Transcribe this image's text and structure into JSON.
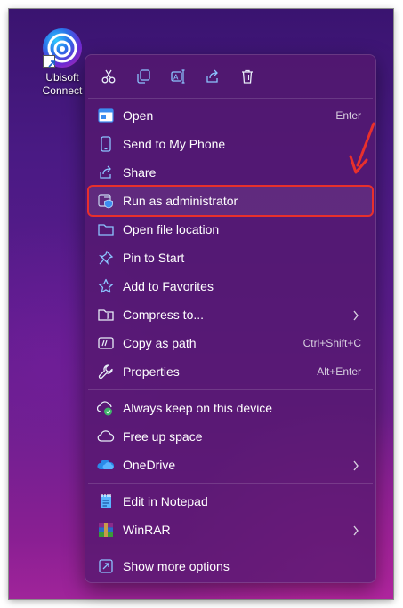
{
  "desktop": {
    "icon_label_line1": "Ubisoft",
    "icon_label_line2": "Connect",
    "icon": "ubisoft-connect-icon"
  },
  "toolbar": [
    {
      "name": "cut",
      "icon": "scissors-icon"
    },
    {
      "name": "copy",
      "icon": "copy-icon"
    },
    {
      "name": "rename",
      "icon": "rename-icon"
    },
    {
      "name": "share",
      "icon": "share-icon"
    },
    {
      "name": "delete",
      "icon": "trash-icon"
    }
  ],
  "menu": {
    "open": {
      "label": "Open",
      "shortcut": "Enter",
      "icon": "app-window-icon"
    },
    "send_to_phone": {
      "label": "Send to My Phone",
      "icon": "phone-icon"
    },
    "share": {
      "label": "Share",
      "icon": "share-icon"
    },
    "run_as_admin": {
      "label": "Run as administrator",
      "icon": "shield-icon"
    },
    "open_file_location": {
      "label": "Open file location",
      "icon": "folder-icon"
    },
    "pin_to_start": {
      "label": "Pin to Start",
      "icon": "pin-icon"
    },
    "add_to_favorites": {
      "label": "Add to Favorites",
      "icon": "star-icon"
    },
    "compress_to": {
      "label": "Compress to...",
      "icon": "zip-folder-icon"
    },
    "copy_as_path": {
      "label": "Copy as path",
      "shortcut": "Ctrl+Shift+C",
      "icon": "path-icon"
    },
    "properties": {
      "label": "Properties",
      "shortcut": "Alt+Enter",
      "icon": "wrench-icon"
    },
    "always_keep": {
      "label": "Always keep on this device",
      "icon": "cloud-sync-icon"
    },
    "free_up_space": {
      "label": "Free up space",
      "icon": "cloud-icon"
    },
    "onedrive": {
      "label": "OneDrive",
      "icon": "onedrive-icon"
    },
    "edit_notepad": {
      "label": "Edit in Notepad",
      "icon": "notepad-icon"
    },
    "winrar": {
      "label": "WinRAR",
      "icon": "winrar-icon"
    },
    "show_more": {
      "label": "Show more options",
      "icon": "more-options-icon"
    }
  },
  "colors": {
    "highlight_outline": "#e8302c",
    "arrow": "#e8302c",
    "menu_text": "#ffffff"
  }
}
